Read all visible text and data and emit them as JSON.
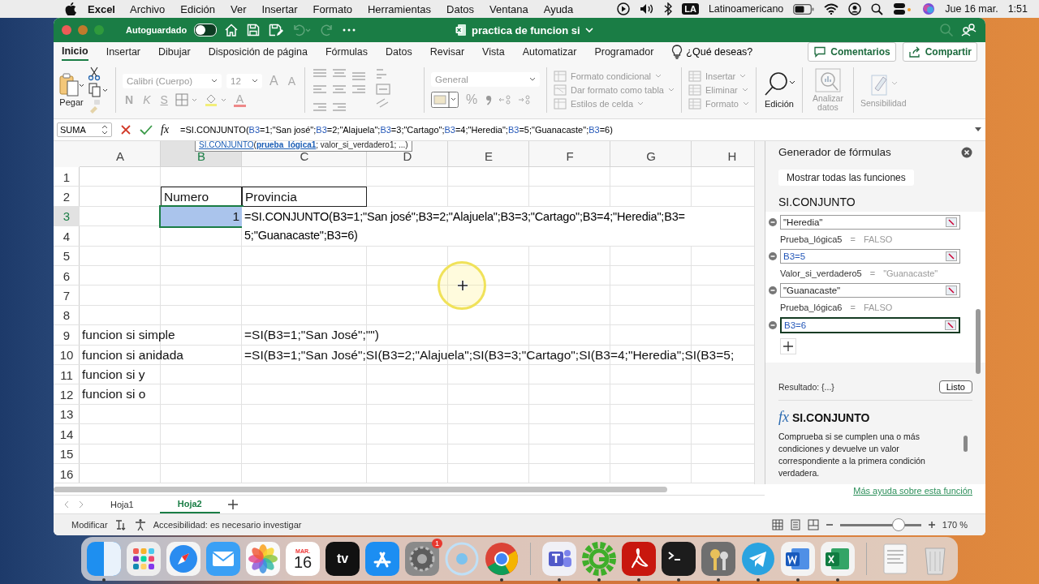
{
  "menu_bar": {
    "app": "Excel",
    "items": [
      "Archivo",
      "Edición",
      "Ver",
      "Insertar",
      "Formato",
      "Herramientas",
      "Datos",
      "Ventana",
      "Ayuda"
    ],
    "input_badge": "LA",
    "input_source": "Latinoamericano",
    "date": "Jue 16 mar.",
    "time": "1:51"
  },
  "title_bar": {
    "autosave_label": "Autoguardado",
    "autosave_on": false,
    "title": "practica de funcion si"
  },
  "ribbon_tabs": [
    {
      "label": "Inicio",
      "selected": true
    },
    {
      "label": "Insertar",
      "selected": false
    },
    {
      "label": "Dibujar",
      "selected": false
    },
    {
      "label": "Disposición de página",
      "selected": false
    },
    {
      "label": "Fórmulas",
      "selected": false
    },
    {
      "label": "Datos",
      "selected": false
    },
    {
      "label": "Revisar",
      "selected": false
    },
    {
      "label": "Vista",
      "selected": false
    },
    {
      "label": "Automatizar",
      "selected": false
    },
    {
      "label": "Programador",
      "selected": false
    }
  ],
  "tell_me": "¿Qué deseas?",
  "comments_button": "Comentarios",
  "share_button": "Compartir",
  "ribbon": {
    "paste": "Pegar",
    "font_name": "Calibri (Cuerpo)",
    "font_size": "12",
    "grow_font": "A",
    "shrink_font": "A",
    "bold": "N",
    "italic": "K",
    "underline": "S",
    "font_color": "A",
    "number_format": "General",
    "percent": "%",
    "styles": [
      "Formato condicional",
      "Dar formato como tabla",
      "Estilos de celda"
    ],
    "cells": [
      "Insertar",
      "Eliminar",
      "Formato"
    ],
    "editing": "Edición",
    "analyze": "Analizar datos",
    "sensitivity": "Sensibilidad"
  },
  "formula_bar": {
    "name_box": "SUMA",
    "fx": "fx",
    "formula": [
      {
        "kind": "text",
        "text": "=SI.CONJUNTO("
      },
      {
        "kind": "ref",
        "text": "B3"
      },
      {
        "kind": "text",
        "text": "=1;\"San josé\";"
      },
      {
        "kind": "ref",
        "text": "B3"
      },
      {
        "kind": "text",
        "text": "=2;\"Alajuela\";"
      },
      {
        "kind": "ref",
        "text": "B3"
      },
      {
        "kind": "text",
        "text": "=3;\"Cartago\";"
      },
      {
        "kind": "ref",
        "text": "B3"
      },
      {
        "kind": "text",
        "text": "=4;\"Heredia\";"
      },
      {
        "kind": "ref",
        "text": "B3"
      },
      {
        "kind": "text",
        "text": "=5;\"Guanacaste\";"
      },
      {
        "kind": "ref",
        "text": "B3"
      },
      {
        "kind": "text",
        "text": "=6)"
      }
    ]
  },
  "tooltip": [
    {
      "kind": "link",
      "text": "SI.CONJUNTO"
    },
    {
      "kind": "text",
      "text": "("
    },
    {
      "kind": "current",
      "text": "prueba_lógica1"
    },
    {
      "kind": "text",
      "text": "; valor_si_verdadero1; ...)"
    }
  ],
  "sheet": {
    "columns": [
      "A",
      "B",
      "C",
      "D",
      "E",
      "F",
      "G",
      "H"
    ],
    "rows": [
      {
        "number": "1"
      },
      {
        "number": "2",
        "cells": {
          "b": {
            "text": "Numero",
            "boxed": true,
            "selected": false
          },
          "c": {
            "text": "Provincia",
            "boxed": true,
            "selected": false
          }
        }
      },
      {
        "number": "3",
        "cells": {
          "b": {
            "text": "1",
            "kind": "number",
            "selected": true
          },
          "c": {
            "kind": "editor",
            "lines": [
              "=SI.CONJUNTO(B3=1;\"San josé\";B3=2;\"Alajuela\";B3=3;\"Cartago\";B3=4;\"Heredia\";B3=",
              "5;\"Guanacaste\";B3=6)"
            ]
          }
        }
      },
      {
        "number": "4"
      },
      {
        "number": "5"
      },
      {
        "number": "6"
      },
      {
        "number": "7"
      },
      {
        "number": "8"
      },
      {
        "number": "9",
        "cells": {
          "a": {
            "text": "funcion si simple",
            "selected": false
          },
          "c": {
            "text": "=SI(B3=1;\"San José\";\"\")",
            "selected": false
          }
        }
      },
      {
        "number": "10",
        "cells": {
          "a": {
            "text": "funcion si anidada",
            "selected": false
          },
          "c": {
            "text": "=SI(B3=1;\"San José\";SI(B3=2;\"Alajuela\";SI(B3=3;\"Cartago\";SI(B3=4;\"Heredia\";SI(B3=5;",
            "selected": false
          }
        }
      },
      {
        "number": "11",
        "cells": {
          "a": {
            "text": "funcion si y",
            "selected": false
          }
        }
      },
      {
        "number": "12",
        "cells": {
          "a": {
            "text": "funcion si o",
            "selected": false
          }
        }
      },
      {
        "number": "13"
      },
      {
        "number": "14"
      },
      {
        "number": "15"
      },
      {
        "number": "16"
      }
    ]
  },
  "side_panel": {
    "title": "Generador de fórmulas",
    "show_all_button": "Mostrar todas las funciones",
    "function_name": "SI.CONJUNTO",
    "arguments": [
      {
        "value": "\"Heredia\"",
        "kind": "text",
        "focused": false
      },
      {
        "label": "Prueba_lógica5",
        "sign": "=",
        "result": "FALSO",
        "value": "B3=5",
        "kind": "ref",
        "focused": false
      },
      {
        "label": "Valor_si_verdadero5",
        "sign": "=",
        "result": "\"Guanacaste\"",
        "value": "\"Guanacaste\"",
        "kind": "text",
        "focused": false
      },
      {
        "label": "Prueba_lógica6",
        "sign": "=",
        "result": "FALSO",
        "value": "B3=6",
        "kind": "ref",
        "focused": true
      }
    ],
    "result": "Resultado: {...}",
    "done_button": "Listo",
    "help_fx": "fx",
    "help_title": "SI.CONJUNTO",
    "help_text": "Comprueba si se cumplen una o más condiciones y devuelve un valor correspondiente a la primera condición verdadera.",
    "help_link": "Más ayuda sobre esta función"
  },
  "sheet_tabs": [
    {
      "label": "Hoja1",
      "selected": false
    },
    {
      "label": "Hoja2",
      "selected": true
    }
  ],
  "status_bar": {
    "mode": "Modificar",
    "accessibility": "Accesibilidad: es necesario investigar",
    "zoom": {
      "level": 0.72,
      "reading": "170 %"
    }
  },
  "dock": [
    {
      "kind": "finder",
      "running": true
    },
    {
      "kind": "launchpad",
      "running": false
    },
    {
      "kind": "safari",
      "running": false
    },
    {
      "kind": "mail",
      "running": false
    },
    {
      "kind": "photos",
      "running": false
    },
    {
      "kind": "calendar",
      "running": false,
      "month": "MAR.",
      "day": "16"
    },
    {
      "kind": "tv",
      "running": false,
      "label": "tv"
    },
    {
      "kind": "appstore",
      "running": false
    },
    {
      "kind": "settings",
      "running": false,
      "badge": "1"
    },
    {
      "kind": "loading",
      "running": false
    },
    {
      "kind": "chrome",
      "running": true
    },
    {
      "kind": "separator"
    },
    {
      "kind": "teams",
      "running": true
    },
    {
      "kind": "greengear",
      "running": true
    },
    {
      "kind": "acrobat",
      "running": true
    },
    {
      "kind": "terminal",
      "running": true
    },
    {
      "kind": "keychain",
      "running": true
    },
    {
      "kind": "telegram",
      "running": true
    },
    {
      "kind": "word",
      "running": true
    },
    {
      "kind": "excel",
      "running": true
    },
    {
      "kind": "separator"
    },
    {
      "kind": "document",
      "running": false
    },
    {
      "kind": "trash",
      "running": false
    }
  ]
}
